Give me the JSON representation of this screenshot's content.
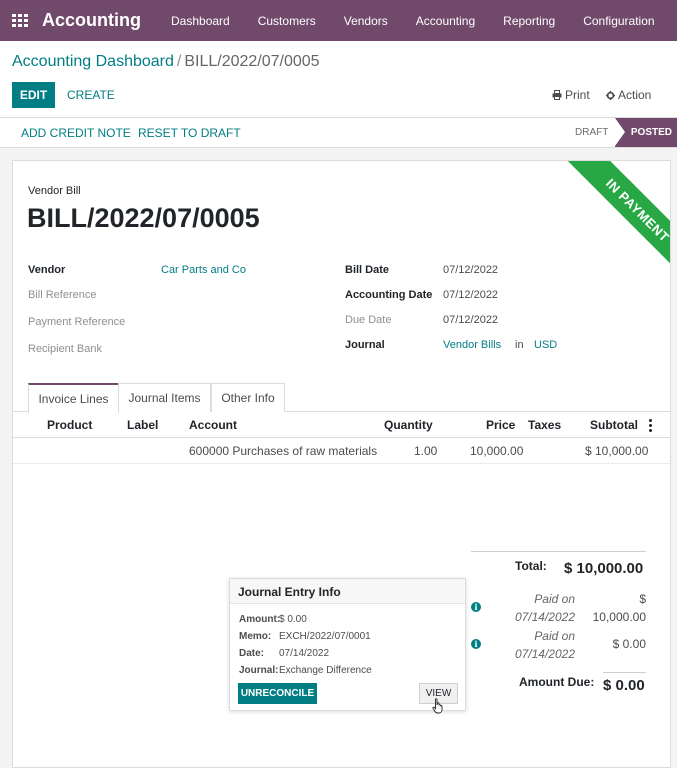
{
  "navbar": {
    "brand": "Accounting",
    "menu": [
      "Dashboard",
      "Customers",
      "Vendors",
      "Accounting",
      "Reporting",
      "Configuration"
    ]
  },
  "breadcrumb": {
    "parent": "Accounting Dashboard",
    "separator": "/",
    "current": "BILL/2022/07/0005"
  },
  "toolbar": {
    "edit": "EDIT",
    "create": "CREATE",
    "print": "Print",
    "action": "Action"
  },
  "statusbar": {
    "add_credit_note": "ADD CREDIT NOTE",
    "reset_to_draft": "RESET TO DRAFT",
    "stage_draft": "DRAFT",
    "stage_posted": "POSTED"
  },
  "ribbon": "IN PAYMENT",
  "document": {
    "type": "Vendor Bill",
    "name": "BILL/2022/07/0005"
  },
  "fields_left": {
    "vendor_label": "Vendor",
    "vendor_value": "Car Parts and Co",
    "bill_reference_label": "Bill Reference",
    "payment_reference_label": "Payment Reference",
    "recipient_bank_label": "Recipient Bank"
  },
  "fields_right": {
    "bill_date_label": "Bill Date",
    "bill_date_value": "07/12/2022",
    "accounting_date_label": "Accounting Date",
    "accounting_date_value": "07/12/2022",
    "due_date_label": "Due Date",
    "due_date_value": "07/12/2022",
    "journal_label": "Journal",
    "journal_value": "Vendor Bills",
    "journal_in": "in",
    "journal_currency": "USD"
  },
  "tabs": [
    "Invoice Lines",
    "Journal Items",
    "Other Info"
  ],
  "table": {
    "columns": [
      "Product",
      "Label",
      "Account",
      "Quantity",
      "Price",
      "Taxes",
      "Subtotal"
    ],
    "rows": [
      {
        "product": "",
        "label": "",
        "account": "600000 Purchases of raw materials",
        "quantity": "1.00",
        "price": "10,000.00",
        "taxes": "",
        "subtotal": "$ 10,000.00"
      }
    ]
  },
  "totals": {
    "total_label": "Total:",
    "total_value": "$ 10,000.00",
    "payments": [
      {
        "label_1": "Paid on",
        "label_2": "07/14/2022",
        "value_1": "$",
        "value_2": "10,000.00"
      },
      {
        "label_1": "Paid on",
        "label_2": "07/14/2022",
        "value_1": "$ 0.00",
        "value_2": ""
      }
    ],
    "amount_due_label": "Amount Due:",
    "amount_due_value": "$ 0.00"
  },
  "popover": {
    "title": "Journal Entry Info",
    "amount_label": "Amount:",
    "amount_value": "$ 0.00",
    "memo_label": "Memo:",
    "memo_value": "EXCH/2022/07/0001",
    "date_label": "Date:",
    "date_value": "07/14/2022",
    "journal_label": "Journal:",
    "journal_value": "Exchange Difference",
    "unreconcile": "UNRECONCILE",
    "view": "VIEW"
  }
}
